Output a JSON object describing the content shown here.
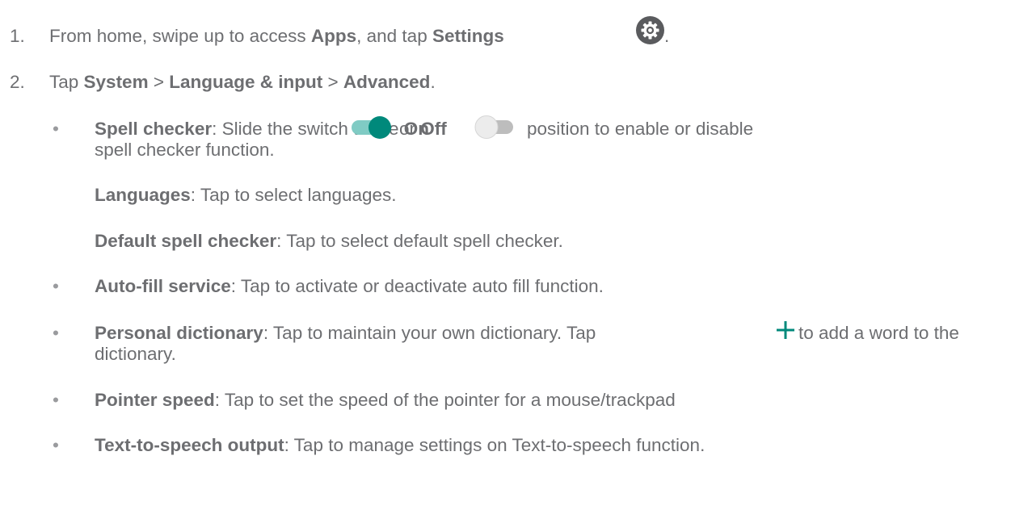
{
  "steps": [
    {
      "number": "1.",
      "t1": "From home, swipe up to access ",
      "b1": "Apps",
      "t2": ", and tap ",
      "b2": "Settings",
      "icon": "settings-gear-icon",
      "t3": "."
    },
    {
      "number": "2.",
      "t1": "Tap ",
      "b1": "System",
      "t2": " > ",
      "b2": "Language & input",
      "t3": " > ",
      "b3": "Advanced",
      "t4": "."
    }
  ],
  "bullet_char": "•",
  "spell_checker": {
    "title": "Spell checker",
    "t1": ": Slide the switch to the ",
    "on": "On",
    "or": " or ",
    "off": "Off",
    "t2": " position to enable or disable",
    "line2": "spell checker function.",
    "on_icon": "toggle-on-icon",
    "off_icon": "toggle-off-icon",
    "colors": {
      "on_thumb": "#00897b",
      "on_track": "#80cbc4",
      "off_thumb": "#ececec",
      "off_track": "#bdbdbd"
    }
  },
  "languages": {
    "title": "Languages",
    "text": ": Tap to select languages."
  },
  "default_spell_checker": {
    "title": "Default spell checker",
    "text": ": Tap to select default spell checker."
  },
  "autofill": {
    "title": "Auto-fill service",
    "text": ": Tap to activate or deactivate auto fill function."
  },
  "personal_dictionary": {
    "title": "Personal dictionary",
    "t1": ": Tap to maintain your own dictionary. Tap ",
    "icon": "plus-icon",
    "t2": " to add a word to the",
    "line2": "dictionary.",
    "icon_color": "#00897b"
  },
  "pointer_speed": {
    "title": "Pointer speed",
    "text": ": Tap to set the speed of the pointer for a mouse/trackpad"
  },
  "tts": {
    "title": "Text-to-speech output",
    "text": ": Tap to manage settings on Text-to-speech function."
  }
}
